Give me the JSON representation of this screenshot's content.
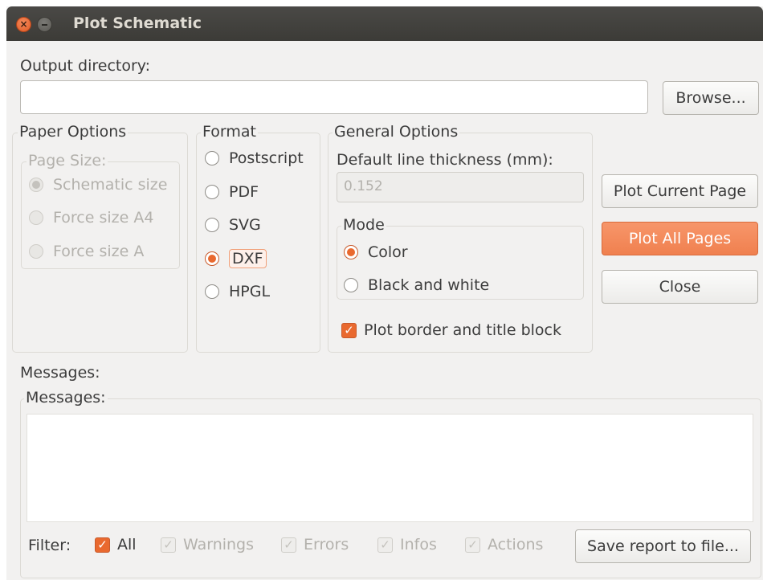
{
  "window": {
    "title": "Plot Schematic",
    "close_glyph": "×"
  },
  "output": {
    "label": "Output directory:",
    "value": "",
    "browse_label": "Browse..."
  },
  "paper_options": {
    "legend": "Paper Options",
    "page_size_legend": "Page Size:",
    "options": [
      {
        "label": "Schematic size",
        "checked": true
      },
      {
        "label": "Force size A4",
        "checked": false
      },
      {
        "label": "Force size A",
        "checked": false
      }
    ]
  },
  "format": {
    "legend": "Format",
    "options": [
      {
        "label": "Postscript",
        "checked": false
      },
      {
        "label": "PDF",
        "checked": false
      },
      {
        "label": "SVG",
        "checked": false
      },
      {
        "label": "DXF",
        "checked": true
      },
      {
        "label": "HPGL",
        "checked": false
      }
    ]
  },
  "general_options": {
    "legend": "General Options",
    "thickness_label": "Default line thickness (mm):",
    "thickness_value": "0.152",
    "mode_legend": "Mode",
    "mode_options": [
      {
        "label": "Color",
        "checked": true
      },
      {
        "label": "Black and white",
        "checked": false
      }
    ],
    "plot_border_label": "Plot border and title block",
    "plot_border_checked": true
  },
  "actions": {
    "plot_current_label": "Plot Current Page",
    "plot_all_label": "Plot All Pages",
    "close_label": "Close"
  },
  "messages": {
    "section_label": "Messages:",
    "group_legend": "Messages:",
    "content": "",
    "filter_label": "Filter:",
    "filters": [
      {
        "label": "All",
        "checked": true,
        "enabled": true
      },
      {
        "label": "Warnings",
        "checked": true,
        "enabled": false
      },
      {
        "label": "Errors",
        "checked": true,
        "enabled": false
      },
      {
        "label": "Infos",
        "checked": true,
        "enabled": false
      },
      {
        "label": "Actions",
        "checked": true,
        "enabled": false
      }
    ],
    "save_report_label": "Save report to file...",
    "check_glyph": "✓"
  },
  "colors": {
    "accent": "#e9692f",
    "titlebar": "#3c3b37",
    "window_bg": "#f2f1f0"
  }
}
